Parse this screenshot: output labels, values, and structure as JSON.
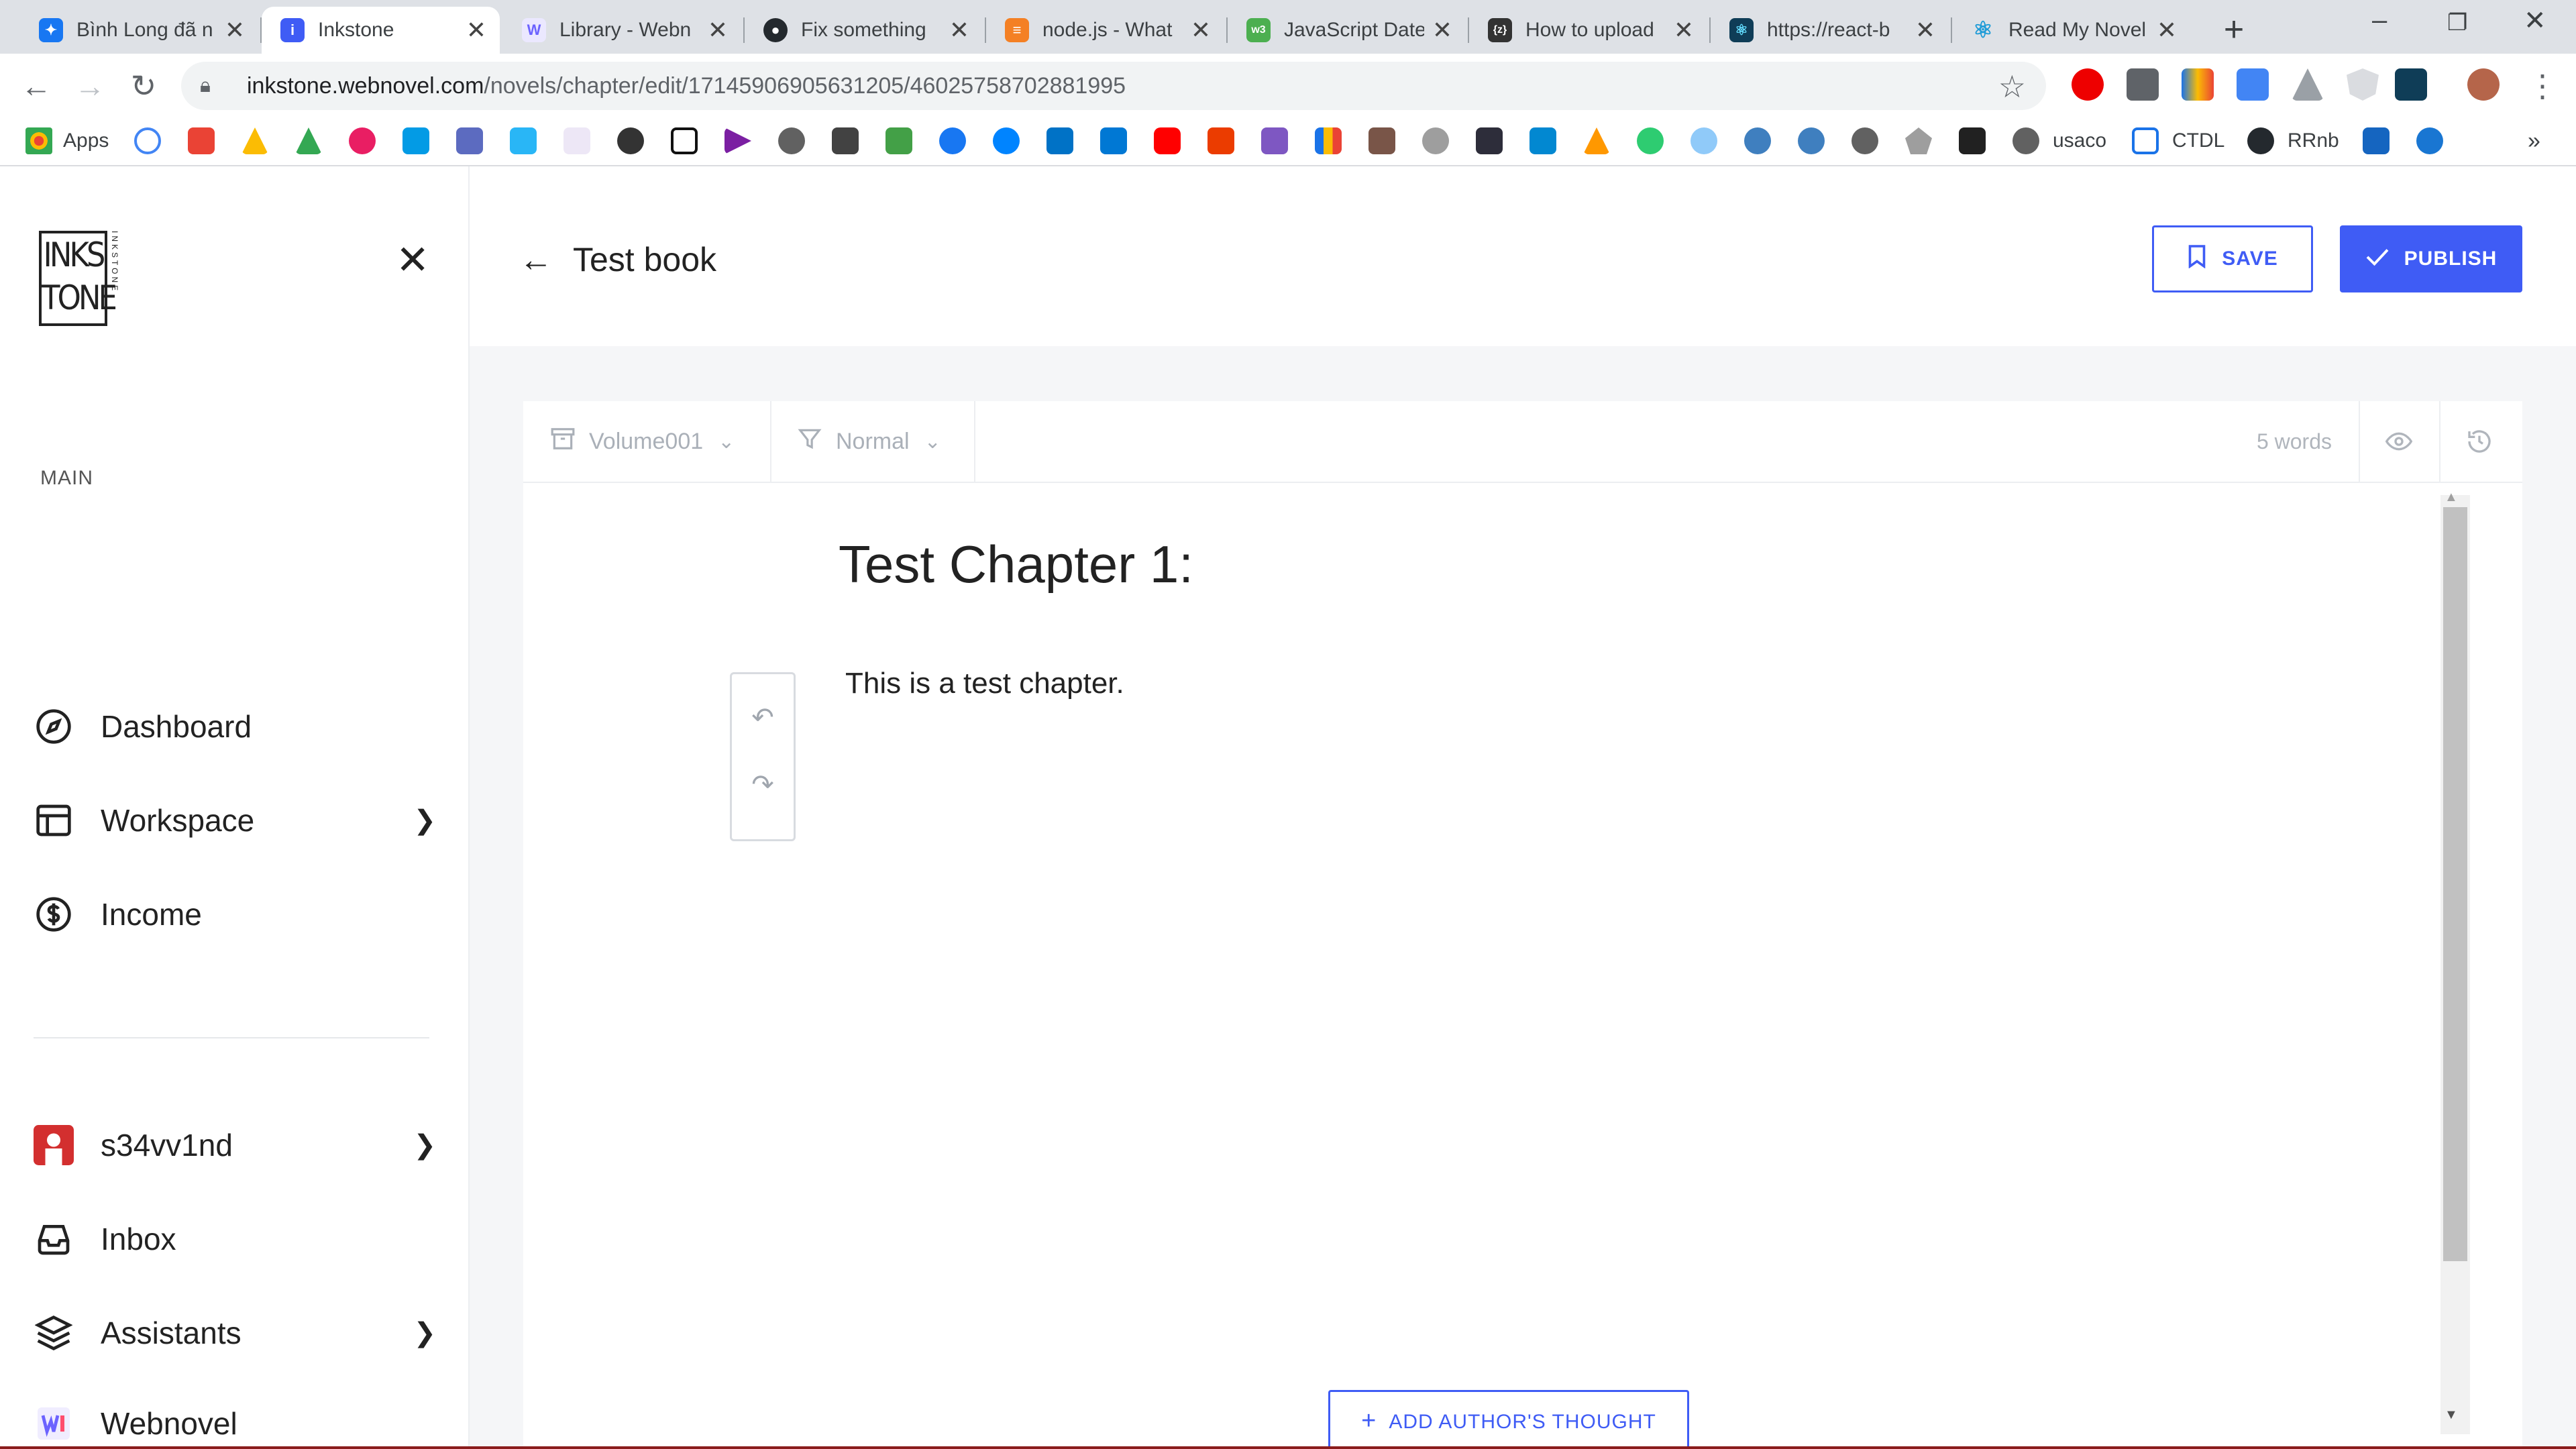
{
  "browser": {
    "tabs": [
      {
        "title": "Bình Long đã n",
        "favicon": "messenger-icon",
        "color": "#1877f2"
      },
      {
        "title": "Inkstone",
        "favicon": "inkstone-icon",
        "color": "#3f5cf5",
        "active": true
      },
      {
        "title": "Library - Webn",
        "favicon": "webnovel-icon",
        "color": "#6c63ff"
      },
      {
        "title": "Fix something",
        "favicon": "github-icon",
        "color": "#24292e"
      },
      {
        "title": "node.js - What",
        "favicon": "stackoverflow-icon",
        "color": "#f48024"
      },
      {
        "title": "JavaScript Date",
        "favicon": "w3schools-icon",
        "color": "#4caf50"
      },
      {
        "title": "How to upload",
        "favicon": "zhihu-icon",
        "color": "#333333"
      },
      {
        "title": "https://react-b",
        "favicon": "react-bootstrap-icon",
        "color": "#0f3d57"
      },
      {
        "title": "Read My Novel",
        "favicon": "react-icon",
        "color": "#61dafb"
      }
    ],
    "url_host": "inkstone.webnovel.com",
    "url_path": "/novels/chapter/edit/17145906905631205/46025758702881995",
    "bookmarks": {
      "apps": "Apps",
      "usaco": "usaco",
      "ctdl": "CTDL",
      "rrnb": "RRnb"
    }
  },
  "sidebar": {
    "logo_text": "INKS TONE",
    "logo_vertical": "INKSTONE",
    "section_label": "MAIN",
    "items": [
      {
        "label": "Dashboard",
        "icon": "compass-icon",
        "has_chevron": false
      },
      {
        "label": "Workspace",
        "icon": "workspace-icon",
        "has_chevron": true
      },
      {
        "label": "Income",
        "icon": "dollar-icon",
        "has_chevron": false
      }
    ],
    "bottom_items": [
      {
        "label": "s34vv1nd",
        "icon": "avatar",
        "has_chevron": true
      },
      {
        "label": "Inbox",
        "icon": "inbox-icon",
        "has_chevron": false
      },
      {
        "label": "Assistants",
        "icon": "layers-icon",
        "has_chevron": true
      },
      {
        "label": "Webnovel",
        "icon": "webnovel-logo-icon",
        "has_chevron": false
      }
    ]
  },
  "header": {
    "book_title": "Test book",
    "save_label": "SAVE",
    "publish_label": "PUBLISH"
  },
  "editor": {
    "volume": "Volume001",
    "chapter_type": "Normal",
    "word_count": "5 words",
    "chapter_title": "Test Chapter 1:",
    "body_text": "This is a test chapter.",
    "author_thought_label": "ADD AUTHOR'S THOUGHT"
  },
  "colors": {
    "accent": "#3f5cf5",
    "chrome_bg": "#dee1e6",
    "app_bg": "#f5f6f8"
  }
}
